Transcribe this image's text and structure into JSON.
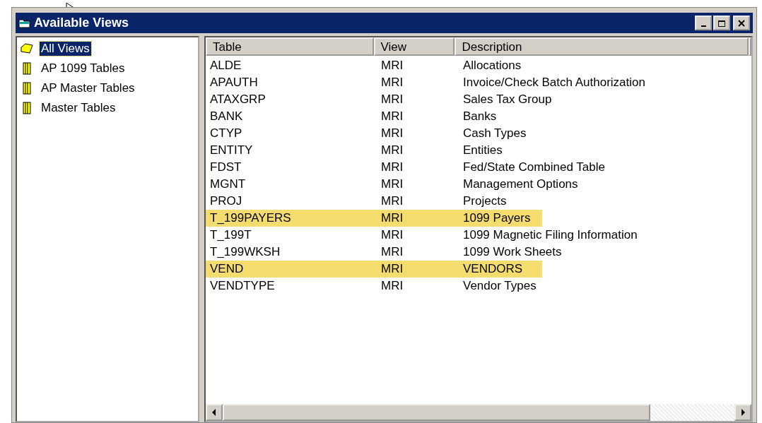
{
  "window": {
    "title": "Available Views"
  },
  "tree": [
    {
      "label": "All Views",
      "selected": true
    },
    {
      "label": "AP 1099 Tables",
      "selected": false
    },
    {
      "label": "AP Master Tables",
      "selected": false
    },
    {
      "label": "Master Tables",
      "selected": false
    }
  ],
  "table": {
    "columns": [
      "Table",
      "View",
      "Description"
    ],
    "rows": [
      {
        "cells": [
          "ALDE",
          "MRI",
          "Allocations"
        ],
        "highlighted": false
      },
      {
        "cells": [
          "APAUTH",
          "MRI",
          "Invoice/Check Batch Authorization"
        ],
        "highlighted": false
      },
      {
        "cells": [
          "ATAXGRP",
          "MRI",
          "Sales Tax Group"
        ],
        "highlighted": false
      },
      {
        "cells": [
          "BANK",
          "MRI",
          "Banks"
        ],
        "highlighted": false
      },
      {
        "cells": [
          "CTYP",
          "MRI",
          "Cash Types"
        ],
        "highlighted": false
      },
      {
        "cells": [
          "ENTITY",
          "MRI",
          "Entities"
        ],
        "highlighted": false
      },
      {
        "cells": [
          "FDST",
          "MRI",
          "Fed/State Combined Table"
        ],
        "highlighted": false
      },
      {
        "cells": [
          "MGNT",
          "MRI",
          "Management Options"
        ],
        "highlighted": false
      },
      {
        "cells": [
          "PROJ",
          "MRI",
          "Projects"
        ],
        "highlighted": false
      },
      {
        "cells": [
          "T_199PAYERS",
          "MRI",
          "1099 Payers"
        ],
        "highlighted": true
      },
      {
        "cells": [
          "T_199T",
          "MRI",
          "1099 Magnetic Filing Information"
        ],
        "highlighted": false
      },
      {
        "cells": [
          "T_199WKSH",
          "MRI",
          "1099 Work Sheets"
        ],
        "highlighted": false
      },
      {
        "cells": [
          "VEND",
          "MRI",
          "VENDORS"
        ],
        "highlighted": true
      },
      {
        "cells": [
          "VENDTYPE",
          "MRI",
          "Vendor Types"
        ],
        "highlighted": false
      }
    ]
  }
}
